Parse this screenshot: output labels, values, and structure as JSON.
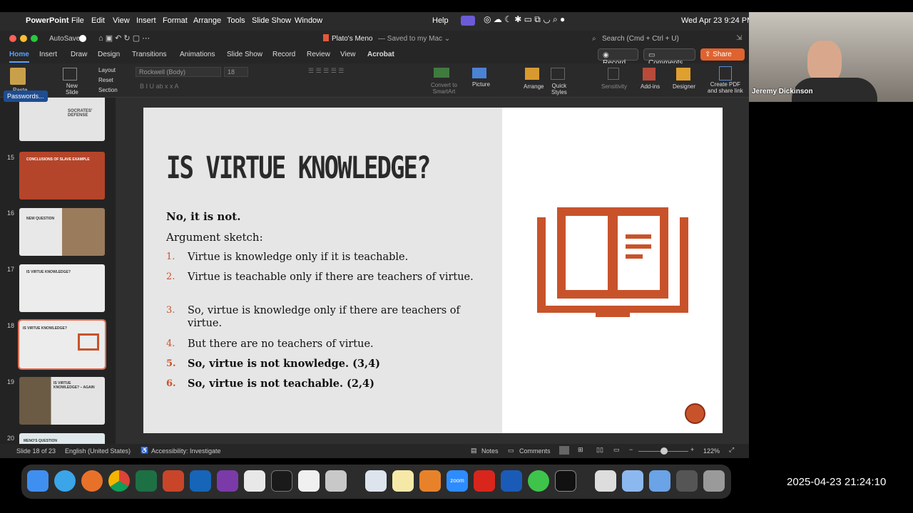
{
  "menubar": {
    "app": "PowerPoint",
    "items": [
      "File",
      "Edit",
      "View",
      "Insert",
      "Format",
      "Arrange",
      "Tools",
      "Slide Show",
      "Window"
    ],
    "help": "Help",
    "clock": "Wed Apr 23  9:24 PM"
  },
  "titlebar": {
    "autosave": "AutoSave",
    "doc_title": "Plato's Meno",
    "saved": "— Saved to my Mac ⌄",
    "search_placeholder": "Search (Cmd + Ctrl + U)"
  },
  "tabs": [
    "Home",
    "Insert",
    "Draw",
    "Design",
    "Transitions",
    "Animations",
    "Slide Show",
    "Record",
    "Review",
    "View",
    "Acrobat"
  ],
  "tab_buttons": {
    "record": "Record",
    "comments": "Comments",
    "share": "Share"
  },
  "ribbon": {
    "paste": "Paste",
    "new_slide": "New\nSlide",
    "layout": "Layout",
    "reset": "Reset",
    "section": "Section",
    "font": "Rockwell (Body)",
    "size": "18",
    "convert": "Convert to\nSmartArt",
    "picture": "Picture",
    "arrange": "Arrange",
    "quick_styles": "Quick\nStyles",
    "sensitivity": "Sensitivity",
    "addins": "Add-ins",
    "designer": "Designer",
    "create_pdf": "Create PDF\nand share link"
  },
  "passwords_badge": "Passwords...",
  "thumbs": [
    {
      "num": "",
      "title": "SOCRATES' DEFENSE"
    },
    {
      "num": "15",
      "title": "CONCLUSIONS OF SLAVE EXAMPLE"
    },
    {
      "num": "16",
      "title": "NEW QUESTION"
    },
    {
      "num": "17",
      "title": "IS VIRTUE KNOWLEDGE?"
    },
    {
      "num": "18",
      "title": "IS VIRTUE KNOWLEDGE?"
    },
    {
      "num": "19",
      "title": "IS VIRTUE KNOWLEDGE? – AGAIN"
    },
    {
      "num": "20",
      "title": "MENO'S QUESTION"
    }
  ],
  "slide": {
    "title": "IS VIRTUE KNOWLEDGE?",
    "answer": "No, it is not.",
    "sketch": "Argument sketch:",
    "items": [
      {
        "n": "1.",
        "text": "Virtue is knowledge only if it is teachable.",
        "bold": false
      },
      {
        "n": "2.",
        "text": "Virtue is teachable only if there are teachers of virtue.",
        "bold": false
      },
      {
        "n": "3.",
        "text": "So, virtue is knowledge only if there are teachers of virtue.",
        "bold": false
      },
      {
        "n": "4.",
        "text": "But there are no teachers of virtue.",
        "bold": false
      },
      {
        "n": "5.",
        "text": "So, virtue is not knowledge. (3,4)",
        "bold": true
      },
      {
        "n": "6.",
        "text": "So, virtue is not teachable. (2,4)",
        "bold": true
      }
    ],
    "accent": "#c8532b"
  },
  "status": {
    "slide": "Slide 18 of 23",
    "lang": "English (United States)",
    "accessibility": "Accessibility: Investigate",
    "notes": "Notes",
    "comments": "Comments",
    "zoom": "122%"
  },
  "video": {
    "name": "Jeremy Dickinson"
  },
  "timestamp": "2025-04-23 21:24:10"
}
